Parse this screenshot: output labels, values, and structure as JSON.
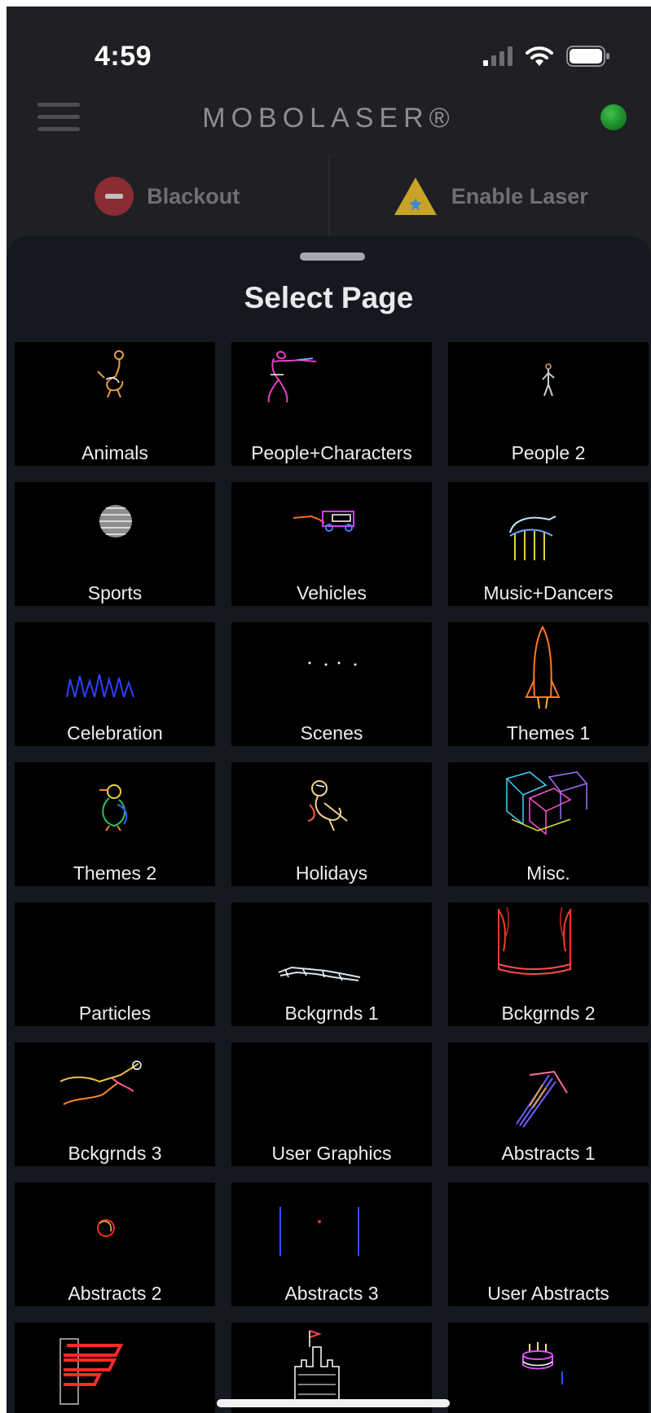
{
  "status_bar": {
    "time": "4:59"
  },
  "nav": {
    "title": "MOBOLASER®"
  },
  "actions": {
    "blackout_label": "Blackout",
    "enable_laser_label": "Enable Laser"
  },
  "sheet": {
    "title": "Select Page",
    "tiles": [
      {
        "label": "Animals",
        "icon": "ostrich-icon"
      },
      {
        "label": "People+Characters",
        "icon": "pink-panther-icon"
      },
      {
        "label": "People 2",
        "icon": "dancer-icon"
      },
      {
        "label": "Sports",
        "icon": "ball-icon"
      },
      {
        "label": "Vehicles",
        "icon": "truck-icon"
      },
      {
        "label": "Music+Dancers",
        "icon": "stage-icon"
      },
      {
        "label": "Celebration",
        "icon": "crowd-icon"
      },
      {
        "label": "Scenes",
        "icon": "dots-icon"
      },
      {
        "label": "Themes 1",
        "icon": "rocket-icon"
      },
      {
        "label": "Themes 2",
        "icon": "duck-icon"
      },
      {
        "label": "Holidays",
        "icon": "cupid-icon"
      },
      {
        "label": "Misc.",
        "icon": "cubes-icon"
      },
      {
        "label": "Particles",
        "icon": "blank-icon"
      },
      {
        "label": "Bckgrnds 1",
        "icon": "skyline-icon"
      },
      {
        "label": "Bckgrnds 2",
        "icon": "curtain-icon"
      },
      {
        "label": "Bckgrnds 3",
        "icon": "swimmer-icon"
      },
      {
        "label": "User Graphics",
        "icon": "blank-icon"
      },
      {
        "label": "Abstracts 1",
        "icon": "ribbon-icon"
      },
      {
        "label": "Abstracts 2",
        "icon": "circle-icon"
      },
      {
        "label": "Abstracts 3",
        "icon": "lines-icon"
      },
      {
        "label": "User Abstracts",
        "icon": "blank-icon"
      },
      {
        "label": "",
        "icon": "p-logo-icon"
      },
      {
        "label": "",
        "icon": "castle-icon"
      },
      {
        "label": "",
        "icon": "cake-icon"
      }
    ]
  },
  "colors": {
    "background": "#1f2023",
    "sheet": "#15181f",
    "connected": "#2db83d",
    "blackout": "#8a2c33",
    "warning": "#c9a227"
  }
}
